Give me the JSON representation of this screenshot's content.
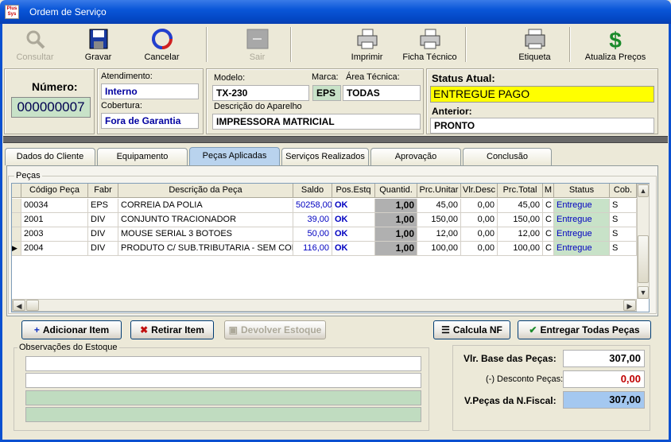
{
  "window": {
    "title": "Ordem de Serviço",
    "app_icon_text": "Plus Sys"
  },
  "toolbar": {
    "consultar": "Consultar",
    "gravar": "Gravar",
    "cancelar": "Cancelar",
    "sair": "Sair",
    "imprimir": "Imprimir",
    "ficha": "Ficha Técnico",
    "etiqueta": "Etiqueta",
    "atualiza": "Atualiza Preços"
  },
  "header": {
    "numero_label": "Número:",
    "numero": "000000007",
    "atendimento_label": "Atendimento:",
    "atendimento": "Interno",
    "cobertura_label": "Cobertura:",
    "cobertura": "Fora de Garantia",
    "modelo_label": "Modelo:",
    "modelo": "TX-230",
    "marca_label": "Marca:",
    "marca": "EPS",
    "area_label": "Área Técnica:",
    "area": "TODAS",
    "descricao_label": "Descrição do Aparelho",
    "descricao": "IMPRESSORA MATRICIAL",
    "status_label": "Status Atual:",
    "status": "ENTREGUE PAGO",
    "anterior_label": "Anterior:",
    "anterior": "PRONTO"
  },
  "tabs": [
    "Dados do Cliente",
    "Equipamento",
    "Peças Aplicadas",
    "Serviços Realizados",
    "Aprovação",
    "Conclusão"
  ],
  "pecas": {
    "group_label": "Peças",
    "columns": [
      "Código Peça",
      "Fabr",
      "Descrição da Peça",
      "Saldo",
      "Pos.Estq",
      "Quantid.",
      "Prc.Unitar",
      "Vlr.Desc",
      "Prc.Total",
      "M",
      "Status",
      "Cob."
    ],
    "rows": [
      {
        "codigo": "00034",
        "fabr": "EPS",
        "descricao": "CORREIA DA POLIA",
        "saldo": "50258,00",
        "pos": "OK",
        "qtd": "1,00",
        "unit": "45,00",
        "desc": "0,00",
        "total": "45,00",
        "m": "C",
        "status": "Entregue",
        "cob": "S"
      },
      {
        "codigo": "2001",
        "fabr": "DIV",
        "descricao": "CONJUNTO TRACIONADOR",
        "saldo": "39,00",
        "pos": "OK",
        "qtd": "1,00",
        "unit": "150,00",
        "desc": "0,00",
        "total": "150,00",
        "m": "C",
        "status": "Entregue",
        "cob": "S"
      },
      {
        "codigo": "2003",
        "fabr": "DIV",
        "descricao": "MOUSE SERIAL 3 BOTOES",
        "saldo": "50,00",
        "pos": "OK",
        "qtd": "1,00",
        "unit": "12,00",
        "desc": "0,00",
        "total": "12,00",
        "m": "C",
        "status": "Entregue",
        "cob": "S"
      },
      {
        "codigo": "2004",
        "fabr": "DIV",
        "descricao": "PRODUTO C/ SUB.TRIBUTARIA - SEM COM",
        "saldo": "116,00",
        "pos": "OK",
        "qtd": "1,00",
        "unit": "100,00",
        "desc": "0,00",
        "total": "100,00",
        "m": "C",
        "status": "Entregue",
        "cob": "S"
      }
    ]
  },
  "buttons": {
    "adicionar": "Adicionar Item",
    "retirar": "Retirar Item",
    "devolver": "Devolver Estoque",
    "calcula": "Calcula NF",
    "entregar": "Entregar Todas Peças"
  },
  "obs": {
    "label": "Observações do Estoque"
  },
  "totais": {
    "base_label": "Vlr. Base das Peças:",
    "base": "307,00",
    "desconto_label": "(-) Desconto Peças:",
    "desconto": "0,00",
    "nf_label": "V.Peças da N.Fiscal:",
    "nf": "307,00"
  },
  "colors": {
    "status_bg": "#ffff00",
    "active_tab": "#b9d3ee",
    "nf_bg": "#a4c8f0",
    "desconto": "#c00000"
  }
}
